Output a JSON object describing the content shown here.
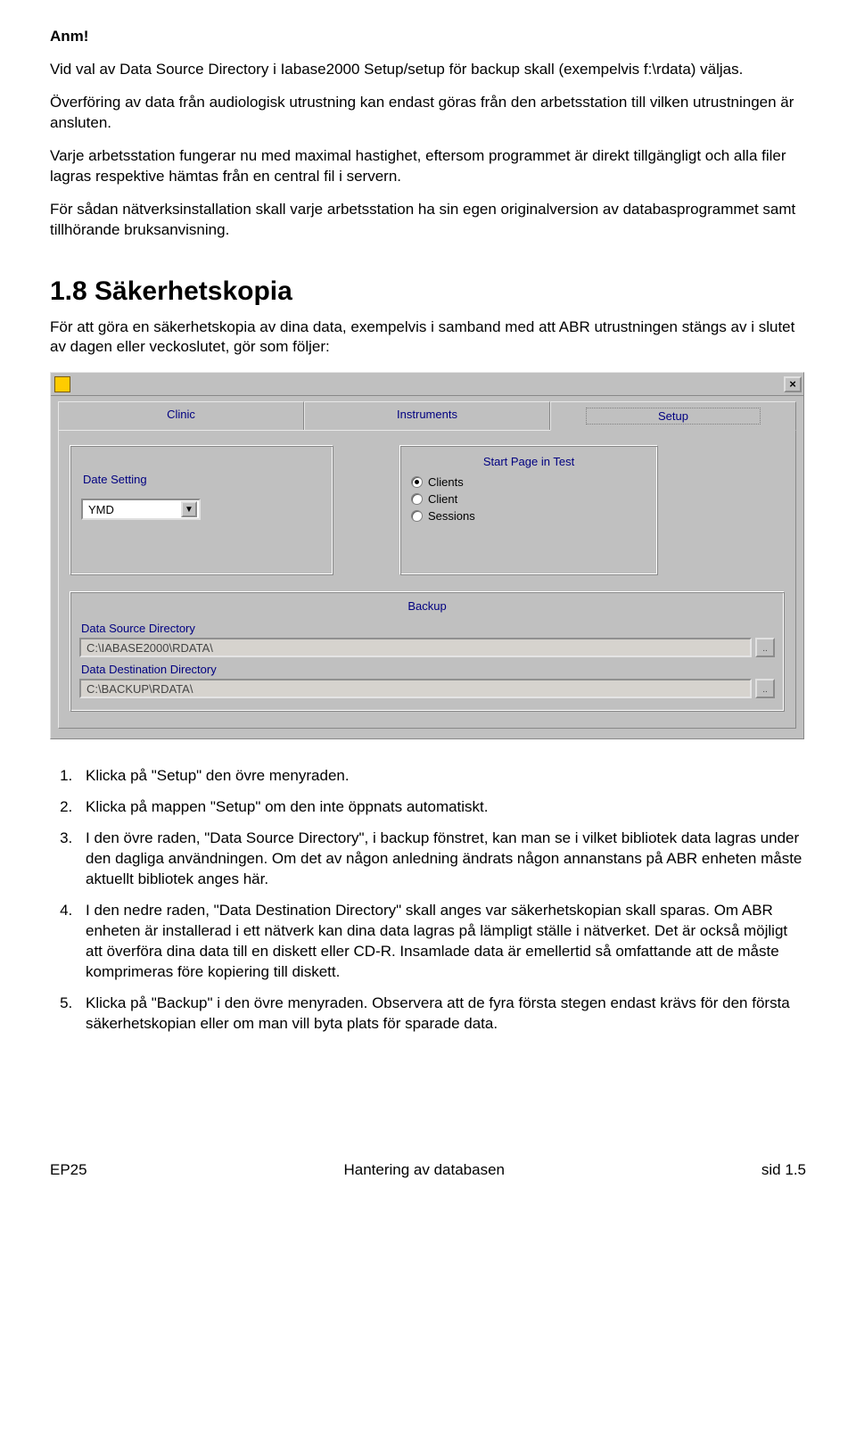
{
  "intro": {
    "note_label": "Anm!",
    "p1": "Vid val av Data Source Directory i Iabase2000 Setup/setup för backup skall (exempelvis f:\\rdata) väljas.",
    "p2": "Överföring av data från audiologisk utrustning kan endast göras från den arbetsstation till vilken utrustningen är ansluten.",
    "p3": "Varje arbetsstation fungerar nu med maximal hastighet, eftersom programmet är direkt tillgängligt och alla filer lagras respektive hämtas från en central fil i servern.",
    "p4": "För sådan nätverksinstallation skall varje arbetsstation ha sin egen originalversion av databasprogrammet samt tillhörande bruksanvisning."
  },
  "section": {
    "heading": "1.8 Säkerhetskopia",
    "lead": "För att göra en säkerhetskopia av dina data, exempelvis i samband med att ABR utrustningen stängs av i slutet av dagen eller veckoslutet, gör som följer:"
  },
  "screenshot": {
    "close_glyph": "×",
    "tabs": {
      "clinic": "Clinic",
      "instruments": "Instruments",
      "setup": "Setup"
    },
    "date_setting": {
      "label": "Date Setting",
      "value": "YMD"
    },
    "start_page": {
      "label": "Start Page in Test",
      "opt1": "Clients",
      "opt2": "Client",
      "opt3": "Sessions"
    },
    "backup": {
      "label": "Backup",
      "src_label": "Data Source Directory",
      "src_value": "C:\\IABASE2000\\RDATA\\",
      "dst_label": "Data Destination Directory",
      "dst_value": "C:\\BACKUP\\RDATA\\",
      "browse": ".."
    }
  },
  "steps": {
    "s1": "Klicka på \"Setup\" den övre menyraden.",
    "s2": "Klicka på mappen \"Setup\" om den inte öppnats automatiskt.",
    "s3": "I den övre raden, \"Data Source Directory\", i backup fönstret, kan man se i vilket bibliotek data lagras under den dagliga användningen. Om det av någon anledning ändrats någon annanstans på ABR enheten måste aktuellt bibliotek anges här.",
    "s4": "I den nedre raden, \"Data Destination Directory\" skall anges var säkerhetskopian skall sparas. Om ABR enheten är installerad i ett nätverk kan dina data lagras på lämpligt ställe i nätverket. Det är också möjligt att överföra dina data till en diskett eller CD-R. Insamlade data är emellertid så omfattande att de måste komprimeras före kopiering till diskett.",
    "s5": "Klicka på \"Backup\" i den övre menyraden. Observera att de fyra första stegen endast krävs för den första säkerhetskopian eller om man vill byta plats för sparade data."
  },
  "footer": {
    "left": "EP25",
    "center": "Hantering av databasen",
    "right": "sid 1.5"
  }
}
